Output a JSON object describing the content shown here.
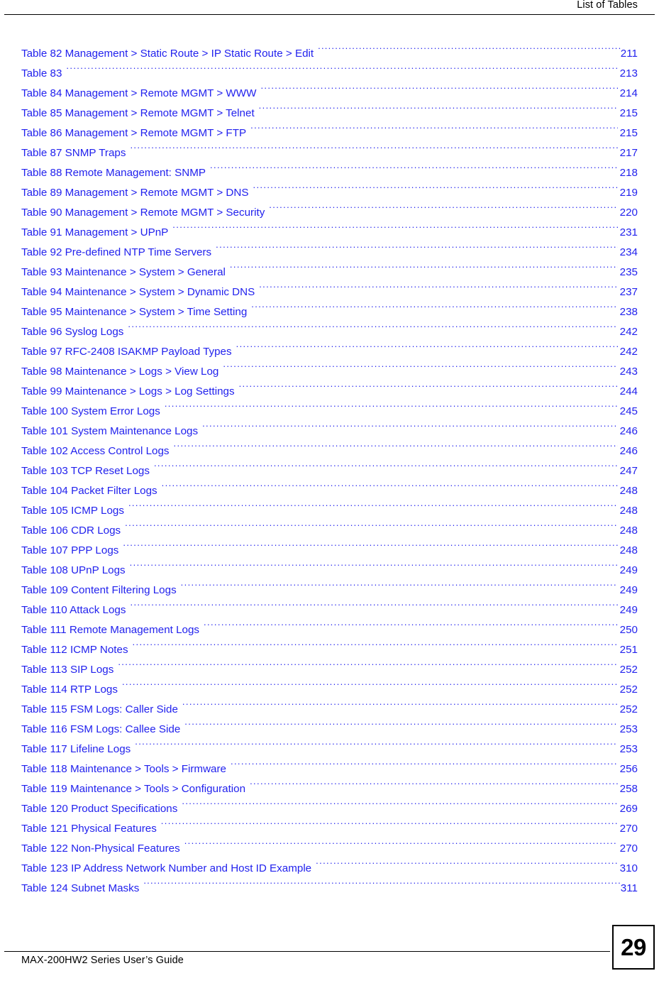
{
  "header": {
    "title": "List of Tables"
  },
  "footer": {
    "document_title": "MAX-200HW2 Series User’s Guide",
    "page_number": "29"
  },
  "colors": {
    "entry_text": "#2222ee",
    "header_text": "#000000",
    "rule": "#000000"
  },
  "list_of_tables": {
    "entries": [
      {
        "label": "Table 82 Management > Static Route > IP Static Route > Edit",
        "page": "211"
      },
      {
        "label": "Table 83",
        "page": "213"
      },
      {
        "label": "Table 84 Management > Remote MGMT > WWW",
        "page": "214"
      },
      {
        "label": "Table 85 Management > Remote MGMT > Telnet",
        "page": "215"
      },
      {
        "label": "Table 86 Management > Remote MGMT > FTP",
        "page": "215"
      },
      {
        "label": "Table 87 SNMP Traps",
        "page": "217"
      },
      {
        "label": "Table 88 Remote Management: SNMP",
        "page": "218"
      },
      {
        "label": "Table 89 Management > Remote MGMT > DNS",
        "page": "219"
      },
      {
        "label": "Table 90 Management > Remote MGMT > Security",
        "page": "220"
      },
      {
        "label": "Table 91 Management > UPnP",
        "page": "231"
      },
      {
        "label": "Table 92 Pre-defined NTP Time Servers",
        "page": "234"
      },
      {
        "label": "Table 93 Maintenance > System > General",
        "page": "235"
      },
      {
        "label": "Table 94 Maintenance > System > Dynamic DNS",
        "page": "237"
      },
      {
        "label": "Table 95 Maintenance > System > Time Setting",
        "page": "238"
      },
      {
        "label": "Table 96 Syslog Logs",
        "page": "242"
      },
      {
        "label": "Table 97 RFC-2408 ISAKMP Payload Types",
        "page": "242"
      },
      {
        "label": "Table 98 Maintenance > Logs > View Log",
        "page": "243"
      },
      {
        "label": "Table 99 Maintenance > Logs > Log Settings",
        "page": "244"
      },
      {
        "label": "Table 100 System Error Logs",
        "page": "245"
      },
      {
        "label": "Table 101 System Maintenance Logs",
        "page": "246"
      },
      {
        "label": "Table 102 Access Control Logs",
        "page": "246"
      },
      {
        "label": "Table 103 TCP Reset Logs",
        "page": "247"
      },
      {
        "label": "Table 104 Packet Filter Logs",
        "page": "248"
      },
      {
        "label": "Table 105 ICMP Logs",
        "page": "248"
      },
      {
        "label": "Table 106 CDR Logs",
        "page": "248"
      },
      {
        "label": "Table 107 PPP Logs",
        "page": "248"
      },
      {
        "label": "Table 108 UPnP Logs",
        "page": "249"
      },
      {
        "label": "Table 109 Content Filtering Logs",
        "page": "249"
      },
      {
        "label": "Table 110 Attack Logs",
        "page": "249"
      },
      {
        "label": "Table 111 Remote Management Logs",
        "page": "250"
      },
      {
        "label": "Table 112 ICMP Notes",
        "page": "251"
      },
      {
        "label": "Table 113 SIP Logs",
        "page": "252"
      },
      {
        "label": "Table 114 RTP Logs",
        "page": "252"
      },
      {
        "label": "Table 115 FSM Logs: Caller Side",
        "page": "252"
      },
      {
        "label": "Table 116 FSM Logs: Callee Side",
        "page": "253"
      },
      {
        "label": "Table 117 Lifeline Logs",
        "page": "253"
      },
      {
        "label": "Table 118 Maintenance > Tools > Firmware",
        "page": "256"
      },
      {
        "label": "Table 119 Maintenance > Tools > Configuration",
        "page": "258"
      },
      {
        "label": "Table 120 Product Specifications",
        "page": "269"
      },
      {
        "label": "Table 121 Physical Features",
        "page": "270"
      },
      {
        "label": "Table 122 Non-Physical Features",
        "page": "270"
      },
      {
        "label": "Table 123 IP Address Network Number and Host ID Example",
        "page": "310"
      },
      {
        "label": "Table 124 Subnet Masks",
        "page": "311"
      }
    ]
  }
}
